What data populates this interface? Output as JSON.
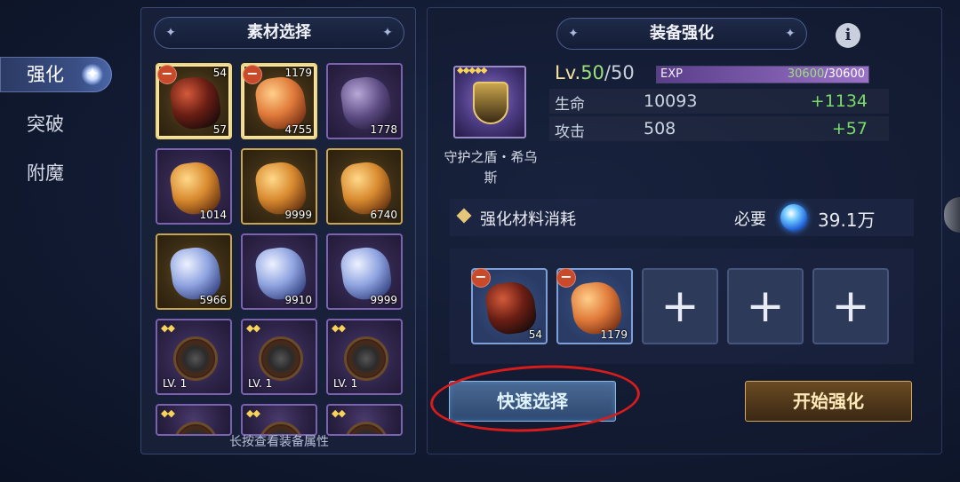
{
  "nav": {
    "tabs": [
      {
        "label": "强化",
        "active": true
      },
      {
        "label": "突破",
        "active": false
      },
      {
        "label": "附魔",
        "active": false
      }
    ]
  },
  "materials": {
    "title": "素材选择",
    "hint": "长按查看装备属性",
    "items": [
      {
        "type": "gem",
        "color": "red",
        "frame": "gold",
        "selected": true,
        "top_count": "54",
        "count": "57",
        "minus": true
      },
      {
        "type": "gem",
        "color": "orange",
        "frame": "gold",
        "selected": true,
        "top_count": "1179",
        "count": "4755",
        "minus": true
      },
      {
        "type": "gem",
        "color": "purple",
        "frame": "purple",
        "selected": false,
        "top_count": "",
        "count": "1778",
        "minus": false
      },
      {
        "type": "gem",
        "color": "amber",
        "frame": "purple",
        "selected": false,
        "top_count": "",
        "count": "1014",
        "minus": false
      },
      {
        "type": "gem",
        "color": "amber",
        "frame": "gold",
        "selected": false,
        "top_count": "",
        "count": "9999",
        "minus": false
      },
      {
        "type": "gem",
        "color": "amber",
        "frame": "gold",
        "selected": false,
        "top_count": "",
        "count": "6740",
        "minus": false
      },
      {
        "type": "gem",
        "color": "blue",
        "frame": "gold",
        "selected": false,
        "top_count": "",
        "count": "5966",
        "minus": false
      },
      {
        "type": "gem",
        "color": "blue",
        "frame": "purple",
        "selected": false,
        "top_count": "",
        "count": "9910",
        "minus": false
      },
      {
        "type": "gem",
        "color": "blue",
        "frame": "purple",
        "selected": false,
        "top_count": "",
        "count": "9999",
        "minus": false
      },
      {
        "type": "shield",
        "frame": "purple",
        "stars": "◆◆",
        "level": "LV. 1"
      },
      {
        "type": "shield",
        "frame": "purple",
        "stars": "◆◆",
        "level": "LV. 1"
      },
      {
        "type": "shield",
        "frame": "purple",
        "stars": "◆◆",
        "level": "LV. 1"
      },
      {
        "type": "shield",
        "frame": "purple",
        "stars": "◆◆",
        "level": ""
      },
      {
        "type": "shield",
        "frame": "purple",
        "stars": "◆◆",
        "level": ""
      },
      {
        "type": "shield",
        "frame": "purple",
        "stars": "◆◆",
        "level": ""
      }
    ]
  },
  "enhance": {
    "title": "装备强化",
    "info_icon": "info-icon",
    "equip": {
      "name": "守护之盾・希乌斯",
      "stars": "◆◆◆◆◆"
    },
    "level": {
      "prefix": "Lv.",
      "current": "50",
      "sep": "/",
      "max": "50",
      "exp_label": "EXP",
      "exp_current": "30600",
      "exp_sep": "/",
      "exp_max": "30600",
      "exp_fraction": 1.0
    },
    "stats": [
      {
        "name": "生命",
        "value": "10093",
        "delta": "+1134"
      },
      {
        "name": "攻击",
        "value": "508",
        "delta": "+57"
      }
    ],
    "cost": {
      "label": "强化材料消耗",
      "required_label": "必要",
      "amount": "39.1万"
    },
    "used_slots": [
      {
        "filled": true,
        "color": "red",
        "count": "54"
      },
      {
        "filled": true,
        "color": "orange",
        "count": "1179"
      },
      {
        "filled": false,
        "plus": "+"
      },
      {
        "filled": false,
        "plus": "+"
      },
      {
        "filled": false,
        "plus": "+"
      }
    ],
    "quick_select_label": "快速选择",
    "start_label": "开始强化"
  },
  "colors": {
    "accent_gold": "#d6a95a",
    "accent_blue": "#8fb6dc",
    "stat_bonus": "#7adc6a",
    "annotation_red": "#d81c1c"
  }
}
